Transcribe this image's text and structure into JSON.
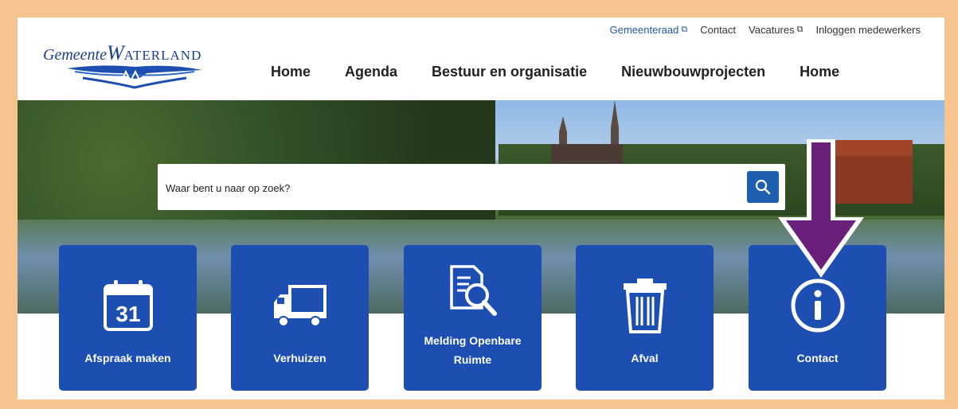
{
  "logo": {
    "text_small": "Gemeente",
    "text_cap_w": "W",
    "text_caps": "ATERLAND"
  },
  "top_links": [
    {
      "label": "Gemeenteraad",
      "external": true
    },
    {
      "label": "Contact",
      "external": false
    },
    {
      "label": "Vacatures",
      "external": true
    },
    {
      "label": "Inloggen medewerkers",
      "external": false
    }
  ],
  "nav": [
    "Home",
    "Agenda",
    "Bestuur en organisatie",
    "Nieuwbouwprojecten",
    "Home"
  ],
  "search": {
    "placeholder": "Waar bent u naar op zoek?"
  },
  "tiles": [
    {
      "label": "Afspraak maken",
      "icon": "calendar-icon",
      "calendar_day": "31"
    },
    {
      "label": "Verhuizen",
      "icon": "truck-icon"
    },
    {
      "label": "Melding Openbare Ruimte",
      "icon": "document-search-icon"
    },
    {
      "label": "Afval",
      "icon": "trash-icon"
    },
    {
      "label": "Contact",
      "icon": "info-icon"
    }
  ],
  "colors": {
    "frame": "#f6c48e",
    "tile": "#1d4fb3",
    "arrow": "#6a1f7a",
    "link_blue": "#1f58a6"
  }
}
